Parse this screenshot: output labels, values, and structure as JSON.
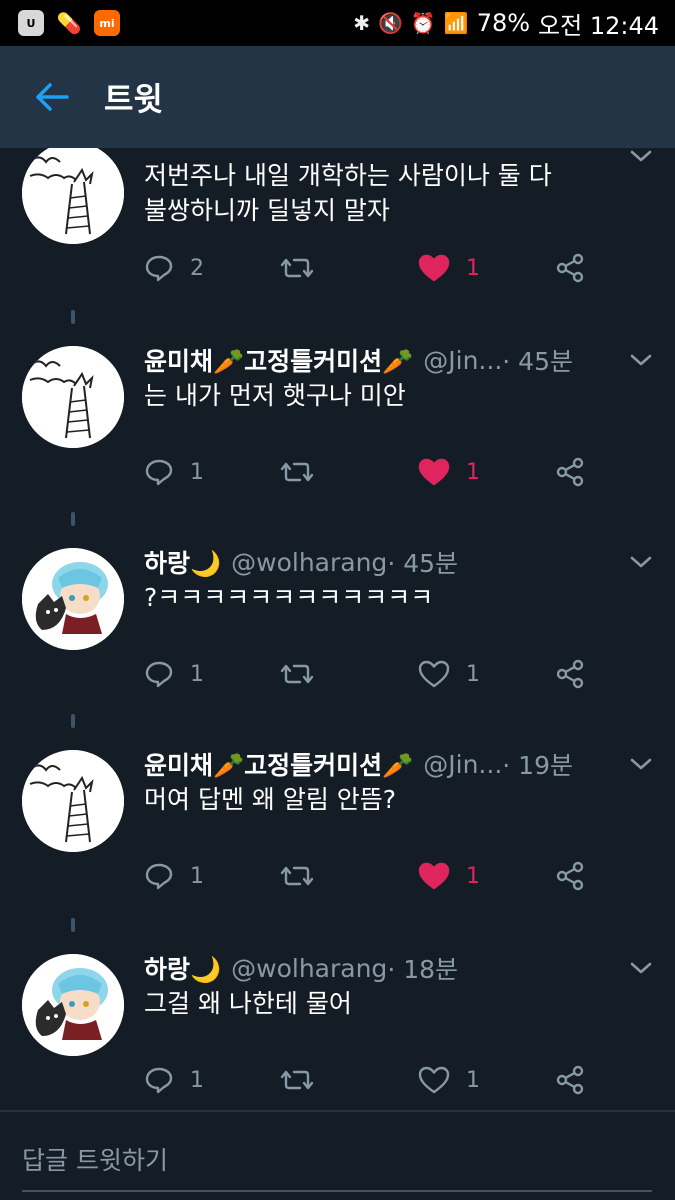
{
  "status_bar": {
    "battery": "78%",
    "time": "오전 12:44",
    "mi_label": "mi"
  },
  "header": {
    "title": "트윗"
  },
  "tweets": [
    {
      "name": "",
      "handle": "",
      "time": "",
      "text": "저번주나 내일 개학하는 사람이나 둘 다\n불쌍하니까 딜넣지 말자",
      "reply_count": "2",
      "like_count": "1",
      "liked": true,
      "avatar": "sketch"
    },
    {
      "name": "윤미채🥕고정틀커미션🥕",
      "handle": "@Jin...",
      "time": " · 45분",
      "text": "는 내가 먼저 햇구나 미안",
      "reply_count": "1",
      "like_count": "1",
      "liked": true,
      "avatar": "sketch"
    },
    {
      "name": "하랑🌙",
      "handle": "@wolharang",
      "time": " · 45분",
      "text": "?ㅋㅋㅋㅋㅋㅋㅋㅋㅋㅋㅋㅋ",
      "reply_count": "1",
      "like_count": "1",
      "liked": false,
      "avatar": "anime"
    },
    {
      "name": "윤미채🥕고정틀커미션🥕",
      "handle": "@Jin...",
      "time": " · 19분",
      "text": "머여 답멘 왜 알림 안뜸?",
      "reply_count": "1",
      "like_count": "1",
      "liked": true,
      "avatar": "sketch"
    },
    {
      "name": "하랑🌙",
      "handle": "@wolharang",
      "time": " · 18분",
      "text": "그걸 왜 나한테 물어",
      "reply_count": "1",
      "like_count": "1",
      "liked": false,
      "avatar": "anime"
    }
  ],
  "reply": {
    "placeholder": "답글 트윗하기"
  },
  "colors": {
    "background": "#141d26",
    "toolbar": "#243447",
    "accent": "#1da1f2",
    "like": "#e0245e",
    "secondary_text": "#8899a6"
  }
}
